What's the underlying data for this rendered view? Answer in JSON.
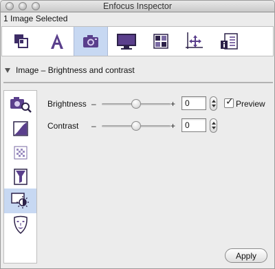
{
  "window": {
    "title": "Enfocus Inspector"
  },
  "selection": {
    "label": "1 Image Selected"
  },
  "toolbar": {
    "tabs": [
      {
        "icon": "layers-icon"
      },
      {
        "icon": "text-icon"
      },
      {
        "icon": "camera-icon",
        "active": true
      },
      {
        "icon": "monitor-icon"
      },
      {
        "icon": "color-blocks-icon"
      },
      {
        "icon": "move-axis-icon"
      },
      {
        "icon": "info-list-icon"
      }
    ]
  },
  "section": {
    "title": "Image – Brightness and contrast"
  },
  "sidebar": {
    "items": [
      {
        "icon": "image-zoom-icon"
      },
      {
        "icon": "curves-icon"
      },
      {
        "icon": "checker-icon"
      },
      {
        "icon": "filter-funnel-icon"
      },
      {
        "icon": "brightness-icon",
        "active": true
      },
      {
        "icon": "mask-icon"
      }
    ]
  },
  "controls": {
    "brightness": {
      "label": "Brightness",
      "minus": "–",
      "plus": "+",
      "value": "0",
      "level": 0.5
    },
    "contrast": {
      "label": "Contrast",
      "minus": "–",
      "plus": "+",
      "value": "0",
      "level": 0.5
    },
    "preview": {
      "label": "Preview",
      "checked": true
    }
  },
  "apply_label": "Apply",
  "colors": {
    "accent": "#c7d8f2",
    "icon_purple": "#5a3f8c"
  }
}
